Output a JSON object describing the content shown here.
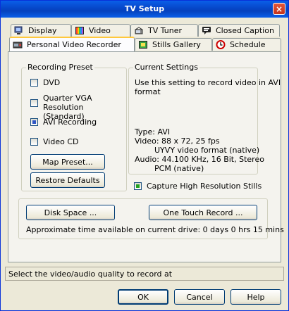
{
  "window": {
    "title": "TV Setup",
    "close_glyph": "×"
  },
  "tabs": {
    "display": "Display",
    "video": "Video",
    "tv_tuner": "TV Tuner",
    "closed_caption": "Closed Caption",
    "pvr": "Personal Video Recorder",
    "stills_gallery": "Stills Gallery",
    "schedule": "Schedule",
    "active": "Personal Video Recorder"
  },
  "recording_preset": {
    "legend": "Recording Preset",
    "options": [
      {
        "label": "DVD",
        "checked": false
      },
      {
        "label_line1": "Quarter VGA",
        "label_line2": "Resolution (Standard)",
        "checked": false
      },
      {
        "label": "AVI Recording",
        "checked": true
      },
      {
        "label": "Video CD",
        "checked": false
      }
    ],
    "map_preset_button": "Map Preset...",
    "restore_defaults_button": "Restore Defaults"
  },
  "current_settings": {
    "legend": "Current Settings",
    "description_line1": "Use this setting to record video in AVI",
    "description_line2": "format",
    "type_line": "Type:  AVI",
    "video_line1": "Video:  88 x 72, 25 fps",
    "video_line2": "UYVY video format (native)",
    "audio_line1": "Audio:  44.100 KHz, 16 Bit, Stereo",
    "audio_line2": "PCM (native)"
  },
  "capture_high_res": {
    "label": "Capture High Resolution Stills",
    "checked": true
  },
  "disk": {
    "disk_space_button": "Disk Space ...",
    "one_touch_button": "One Touch Record ...",
    "approx_time": "Approximate time available on current drive: 0 days 0 hrs 15 mins"
  },
  "status": {
    "text": "Select the video/audio quality to record at"
  },
  "footer": {
    "ok": "OK",
    "cancel": "Cancel",
    "help": "Help"
  },
  "colors": {
    "title_bar": "#0a5fe8",
    "dialog_bg": "#ece9d8",
    "active_tab_accent": "#ffc83c",
    "close_button": "#e4573a"
  },
  "icons": [
    "display-icon",
    "video-icon",
    "tv-tuner-icon",
    "closed-caption-icon",
    "pvr-icon",
    "stills-gallery-icon",
    "schedule-icon"
  ]
}
